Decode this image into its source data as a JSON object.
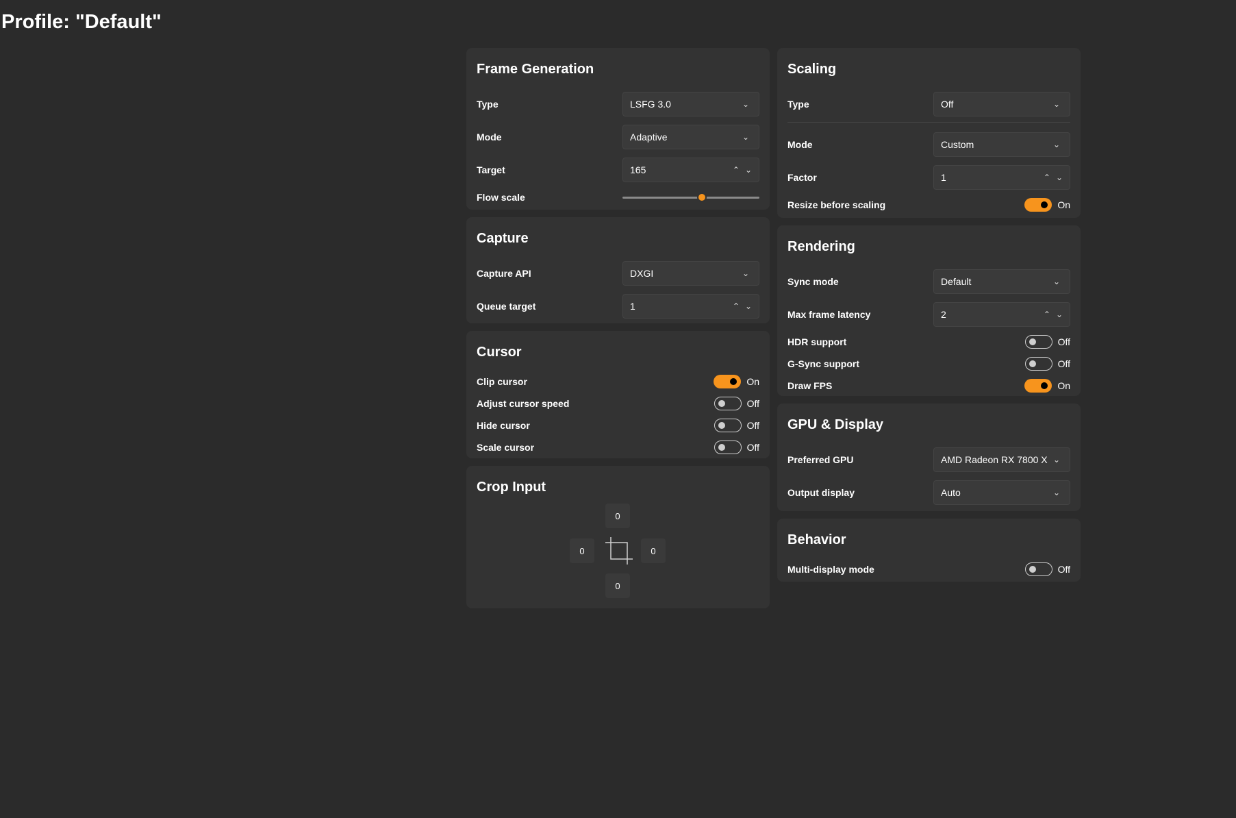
{
  "page": {
    "title": "Profile: \"Default\""
  },
  "colors": {
    "accent": "#f7941d",
    "background": "#2b2b2b",
    "card": "#333333"
  },
  "frame_generation": {
    "title": "Frame Generation",
    "type_label": "Type",
    "type_value": "LSFG 3.0",
    "mode_label": "Mode",
    "mode_value": "Adaptive",
    "target_label": "Target",
    "target_value": "165",
    "flow_scale_label": "Flow scale",
    "flow_scale_fraction": 0.58
  },
  "capture": {
    "title": "Capture",
    "api_label": "Capture API",
    "api_value": "DXGI",
    "queue_label": "Queue target",
    "queue_value": "1"
  },
  "cursor": {
    "title": "Cursor",
    "items": [
      {
        "label": "Clip cursor",
        "state": "On"
      },
      {
        "label": "Adjust cursor speed",
        "state": "Off"
      },
      {
        "label": "Hide cursor",
        "state": "Off"
      },
      {
        "label": "Scale cursor",
        "state": "Off"
      }
    ]
  },
  "crop_input": {
    "title": "Crop Input",
    "top": "0",
    "left": "0",
    "right": "0",
    "bottom": "0"
  },
  "scaling": {
    "title": "Scaling",
    "type_label": "Type",
    "type_value": "Off",
    "mode_label": "Mode",
    "mode_value": "Custom",
    "factor_label": "Factor",
    "factor_value": "1",
    "resize_label": "Resize before scaling",
    "resize_state": "On"
  },
  "rendering": {
    "title": "Rendering",
    "sync_label": "Sync mode",
    "sync_value": "Default",
    "latency_label": "Max frame latency",
    "latency_value": "2",
    "hdr_label": "HDR support",
    "hdr_state": "Off",
    "gsync_label": "G-Sync support",
    "gsync_state": "Off",
    "fps_label": "Draw FPS",
    "fps_state": "On"
  },
  "gpu_display": {
    "title": "GPU & Display",
    "gpu_label": "Preferred GPU",
    "gpu_value": "AMD Radeon RX 7800 X",
    "output_label": "Output display",
    "output_value": "Auto"
  },
  "behavior": {
    "title": "Behavior",
    "multi_label": "Multi-display mode",
    "multi_state": "Off"
  }
}
